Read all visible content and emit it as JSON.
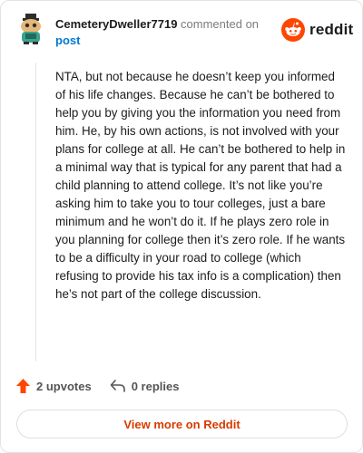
{
  "comment": {
    "username": "CemeteryDweller7719",
    "action_text": "commented on",
    "post_link_label": "post",
    "body": "NTA, but not because he doesn’t keep you informed of his life changes. Because he can’t be bothered to help you by giving you the information you need from him. He, by his own actions, is not involved with your plans for college at all. He can’t be bothered to help in a minimal way that is typical for any parent that had a child planning to attend college. It’s not like you’re asking him to take you to tour colleges, just a bare minimum and he won’t do it. If he plays zero role in you planning for college then it’s zero role. If he wants to be a difficulty in your road to college (which refusing to provide his tax info is a complication) then he’s not part of the college discussion."
  },
  "brand": {
    "logo_text": "reddit",
    "color": "#ff4500"
  },
  "stats": {
    "upvotes": "2 upvotes",
    "replies": "0 replies"
  },
  "actions": {
    "view_more": "View more on Reddit"
  },
  "icons": {
    "avatar": "snoo-avatar-icon",
    "upvote": "upvote-arrow-icon",
    "reply": "reply-arrow-icon",
    "logo": "reddit-snoo-icon"
  }
}
